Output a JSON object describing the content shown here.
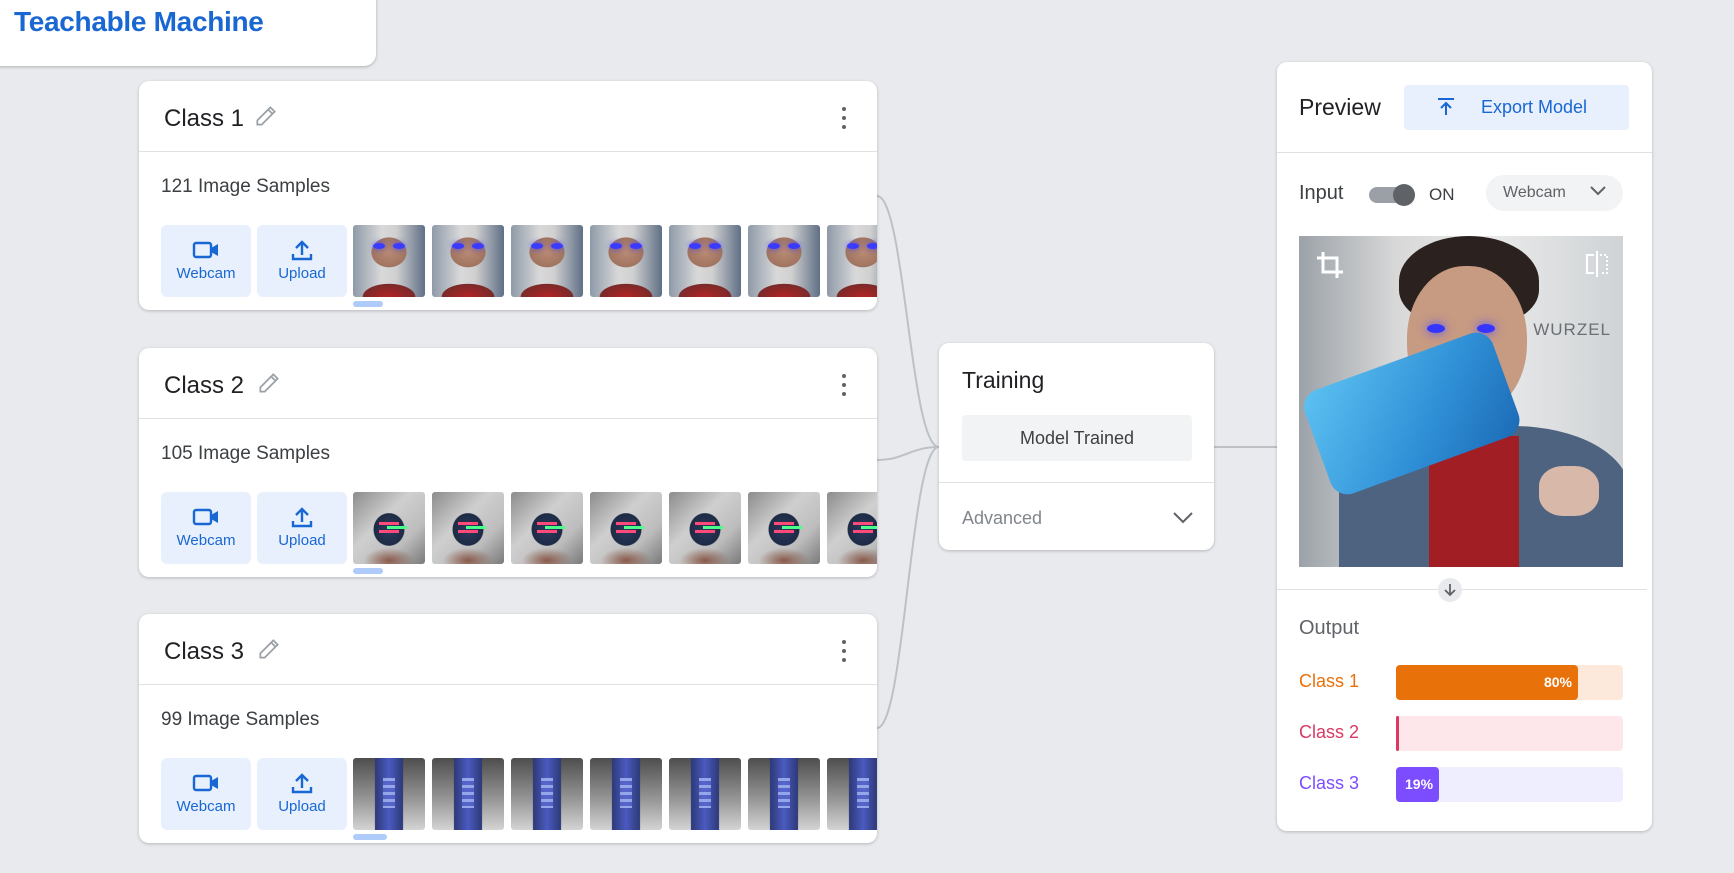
{
  "app": {
    "title": "Teachable Machine"
  },
  "classes": [
    {
      "name": "Class 1",
      "samples_label": "121 Image Samples",
      "thumb_style": "face"
    },
    {
      "name": "Class 2",
      "samples_label": "105 Image Samples",
      "thumb_style": "board"
    },
    {
      "name": "Class 3",
      "samples_label": "99 Image Samples",
      "thumb_style": "phone"
    }
  ],
  "class_buttons": {
    "webcam": "Webcam",
    "upload": "Upload"
  },
  "training": {
    "title": "Training",
    "status": "Model Trained",
    "advanced": "Advanced"
  },
  "preview": {
    "title": "Preview",
    "export_label": "Export Model",
    "input_label": "Input",
    "toggle_state": "ON",
    "input_source": "Webcam",
    "webcam_overlay_text": "WURZEL",
    "output_label": "Output",
    "outputs": [
      {
        "label": "Class 1",
        "percent": 80,
        "percent_text": "80%",
        "color": "#e8710a",
        "bg": "#fde8dc"
      },
      {
        "label": "Class 2",
        "percent": 1,
        "percent_text": "",
        "color": "#d93965",
        "bg": "#fde7ea"
      },
      {
        "label": "Class 3",
        "percent": 19,
        "percent_text": "19%",
        "color": "#7c4dff",
        "bg": "#efeefe"
      }
    ]
  },
  "colors": {
    "accent": "#1967d2",
    "accent_bg": "#e8f0fe"
  }
}
